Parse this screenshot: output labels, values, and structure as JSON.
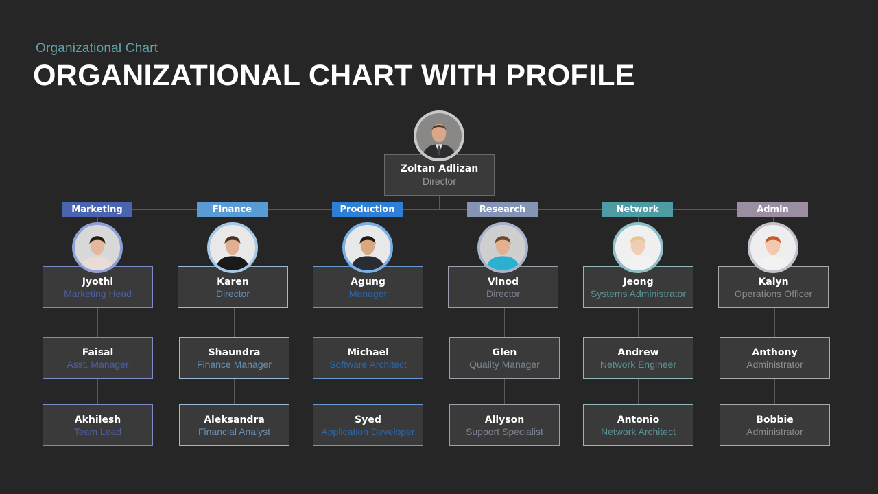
{
  "header": {
    "subtitle": "Organizational  Chart",
    "title": "ORGANIZATIONAL CHART WITH PROFILE"
  },
  "root": {
    "name": "Zoltan Adlizan",
    "role": "Director",
    "avatar_icon": "person-photo-icon"
  },
  "departments": [
    {
      "label": "Marketing",
      "color": "#4a64b0",
      "role_color": "#4e5f9e",
      "head": {
        "name": "Jyothi",
        "role": "Marketing Head"
      },
      "members": [
        {
          "name": "Faisal",
          "role": "Asst. Manager"
        },
        {
          "name": "Akhilesh",
          "role": "Team Lead"
        }
      ]
    },
    {
      "label": "Finance",
      "color": "#5b9bd5",
      "role_color": "#6a8fb5",
      "head": {
        "name": "Karen",
        "role": "Director"
      },
      "members": [
        {
          "name": "Shaundra",
          "role": "Finance Manager"
        },
        {
          "name": "Aleksandra",
          "role": "Financial Analyst"
        }
      ]
    },
    {
      "label": "Production",
      "color": "#2e7fd6",
      "role_color": "#2f66a8",
      "head": {
        "name": "Agung",
        "role": "Manager"
      },
      "members": [
        {
          "name": "Michael",
          "role": "Software Architect"
        },
        {
          "name": "Syed",
          "role": "Application Developer"
        }
      ]
    },
    {
      "label": "Research",
      "color": "#8594b4",
      "role_color": "#7d8595",
      "head": {
        "name": "Vinod",
        "role": "Director"
      },
      "members": [
        {
          "name": "Glen",
          "role": "Quality Manager"
        },
        {
          "name": "Allyson",
          "role": "Support Specialist"
        }
      ]
    },
    {
      "label": "Network",
      "color": "#4f9ba3",
      "role_color": "#5b9298",
      "head": {
        "name": "Jeong",
        "role": "Systems Administrator"
      },
      "members": [
        {
          "name": "Andrew",
          "role": "Network Engineer"
        },
        {
          "name": "Antonio",
          "role": "Network Architect"
        }
      ]
    },
    {
      "label": "Admin",
      "color": "#9a8ea0",
      "role_color": "#8f8a92",
      "head": {
        "name": "Kalyn",
        "role": "Operations Officer"
      },
      "members": [
        {
          "name": "Anthony",
          "role": "Administrator"
        },
        {
          "name": "Bobbie",
          "role": "Administrator"
        }
      ]
    }
  ]
}
